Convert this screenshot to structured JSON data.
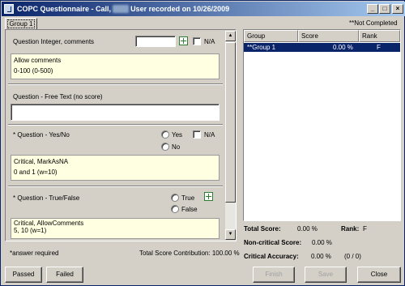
{
  "window": {
    "title_prefix": "COPC Questionnaire - Call,",
    "title_redacted": "xxxx",
    "title_suffix": "User recorded on 10/26/2009",
    "minimize_glyph": "_",
    "maximize_glyph": "□",
    "close_glyph": "×"
  },
  "status_not_completed": "**Not Completed",
  "tabs": [
    {
      "label": "Group 1",
      "selected": true
    }
  ],
  "questions": {
    "q1": {
      "label": "Question Integer, comments",
      "value": "",
      "na_label": "N/A",
      "note_line1": "Allow comments",
      "note_line2": "0-100 (0-500)"
    },
    "q2": {
      "label": "Question - Free Text (no score)",
      "value": ""
    },
    "q3": {
      "label": "* Question - Yes/No",
      "option_yes": "Yes",
      "option_no": "No",
      "na_label": "N/A",
      "note_line1": "Critical, MarkAsNA",
      "note_line2": "0 and 1 (w=10)"
    },
    "q4": {
      "label": "* Question - True/False",
      "option_true": "True",
      "option_false": "False",
      "note_line1": "Critical, AllowComments",
      "note_line2": "5, 10 (w=1)"
    }
  },
  "footer_left": {
    "required_note": "*answer required",
    "contribution_label": "Total Score Contribution:",
    "contribution_value": "100.00 %"
  },
  "grid": {
    "columns": [
      "Group",
      "Score",
      "Rank"
    ],
    "rows": [
      {
        "group": "**Group 1",
        "score": "0.00 %",
        "rank": "F",
        "selected": true
      }
    ]
  },
  "summary": {
    "total_score_label": "Total Score:",
    "total_score_value": "0.00 %",
    "rank_label": "Rank:",
    "rank_value": "F",
    "noncritical_label": "Non-critical Score:",
    "noncritical_value": "0.00 %",
    "critical_label": "Critical Accuracy:",
    "critical_value": "0.00 %",
    "critical_count": "(0 / 0)"
  },
  "buttons": {
    "passed": "Passed",
    "failed": "Failed",
    "finish": "Finish",
    "save": "Save",
    "close": "Close"
  },
  "colors": {
    "titlebar_start": "#0a246a",
    "titlebar_end": "#a6caf0",
    "selection": "#0a246a",
    "note_bg": "#ffffe1"
  },
  "icons": {
    "add": "add-comment-icon",
    "app": "app-icon"
  }
}
